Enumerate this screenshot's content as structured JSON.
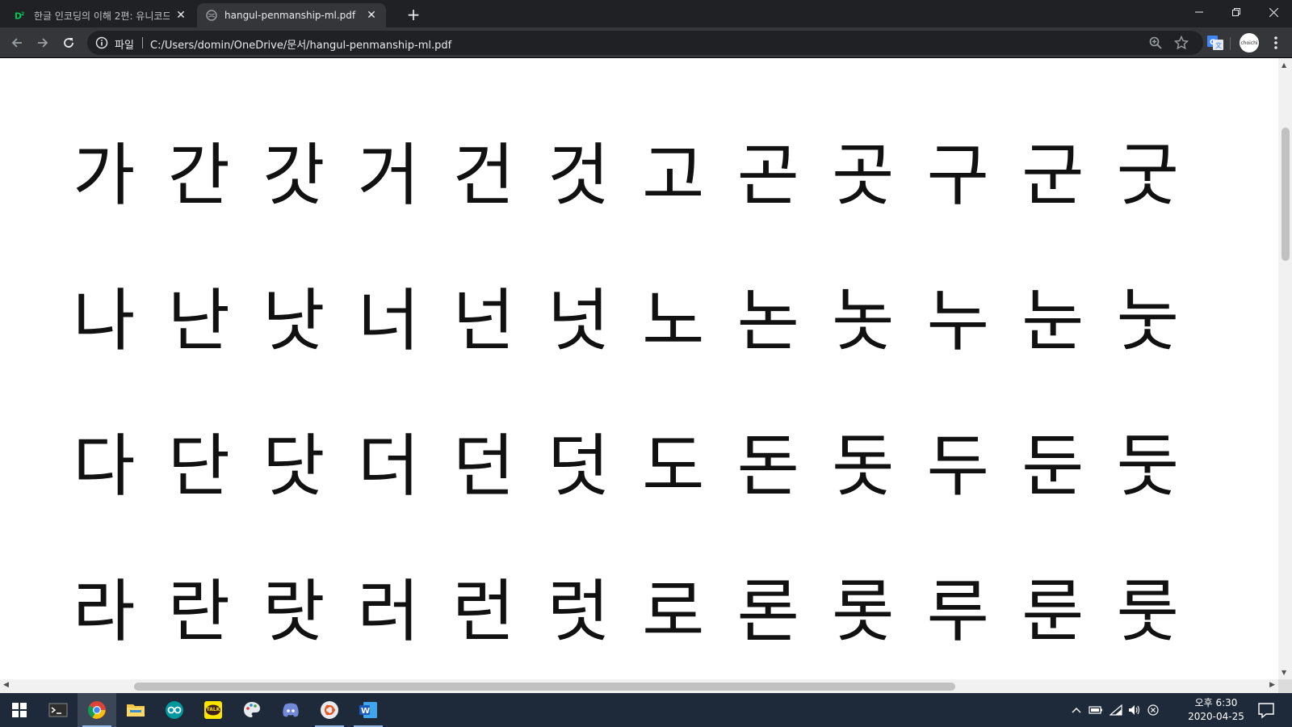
{
  "browser": {
    "tabs": [
      {
        "title": "한글 인코딩의 이해 2편: 유니코드",
        "favicon": "d2-favicon",
        "active": false
      },
      {
        "title": "hangul-penmanship-ml.pdf",
        "favicon": "globe-favicon",
        "active": true
      }
    ],
    "omnibox": {
      "scheme_label": "파일",
      "url": "C:/Users/domin/OneDrive/문서/hangul-penmanship-ml.pdf"
    },
    "avatar_label": "choichi",
    "colors": {
      "tabstrip": "#202124",
      "toolbar": "#35363a",
      "omnibox": "#202124",
      "text": "#e8eaed"
    }
  },
  "pdf": {
    "rows": [
      [
        "가",
        "간",
        "갓",
        "거",
        "건",
        "것",
        "고",
        "곤",
        "곳",
        "구",
        "군",
        "굿"
      ],
      [
        "나",
        "난",
        "낫",
        "너",
        "넌",
        "넛",
        "노",
        "논",
        "놋",
        "누",
        "눈",
        "눗"
      ],
      [
        "다",
        "단",
        "닷",
        "더",
        "던",
        "덧",
        "도",
        "돈",
        "돗",
        "두",
        "둔",
        "둣"
      ],
      [
        "라",
        "란",
        "랏",
        "러",
        "런",
        "럿",
        "로",
        "론",
        "롯",
        "루",
        "룬",
        "룻"
      ]
    ]
  },
  "taskbar": {
    "apps": [
      "start-icon",
      "terminal-icon",
      "chrome-icon",
      "file-explorer-icon",
      "arduino-icon",
      "kakaotalk-icon",
      "paint-icon",
      "discord-icon",
      "ubuntu-icon",
      "word-icon"
    ],
    "kakao_label": "TALK",
    "clock": {
      "time": "오후 6:30",
      "date": "2020-04-25"
    }
  }
}
